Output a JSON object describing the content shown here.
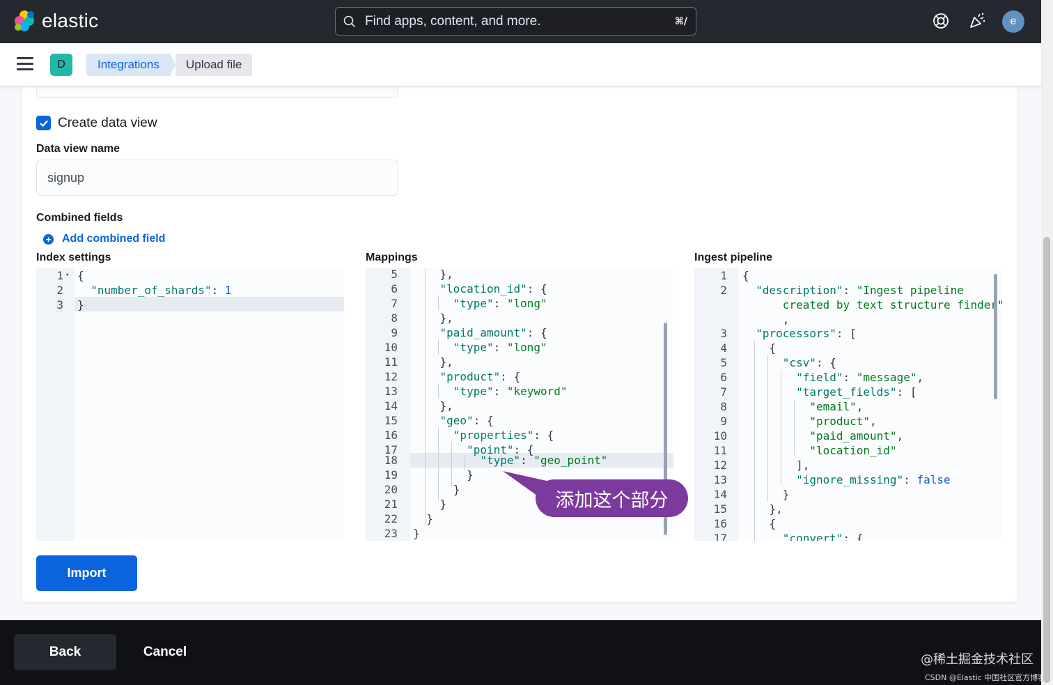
{
  "app": {
    "name": "elastic"
  },
  "search": {
    "placeholder": "Find apps, content, and more.",
    "shortcut": "⌘/"
  },
  "user": {
    "avatar_letter": "e"
  },
  "space": {
    "badge": "D"
  },
  "breadcrumbs": [
    "Integrations",
    "Upload file"
  ],
  "form": {
    "create_data_view_label": "Create data view",
    "create_data_view_checked": true,
    "data_view_name_label": "Data view name",
    "data_view_name_value": "signup",
    "combined_fields_label": "Combined fields",
    "add_combined_field": "Add combined field"
  },
  "editors": {
    "index_settings": {
      "title": "Index settings",
      "lines": [
        "1",
        "2",
        "3"
      ]
    },
    "mappings": {
      "title": "Mappings",
      "lines": [
        "5",
        "6",
        "7",
        "8",
        "9",
        "10",
        "11",
        "12",
        "13",
        "14",
        "15",
        "16",
        "17",
        "18",
        "19",
        "20",
        "21",
        "22",
        "23"
      ]
    },
    "ingest_pipeline": {
      "title": "Ingest pipeline",
      "lines": [
        "1",
        "2",
        "3",
        "4",
        "5",
        "6",
        "7",
        "8",
        "9",
        "10",
        "11",
        "12",
        "13",
        "14",
        "15",
        "16",
        "17"
      ]
    }
  },
  "callout": {
    "text": "添加这个部分"
  },
  "buttons": {
    "import": "Import",
    "back": "Back",
    "cancel": "Cancel"
  },
  "watermarks": {
    "line1": "@稀土掘金技术社区",
    "line2": "CSDN @Elastic 中国社区官方博客"
  },
  "colors": {
    "primary": "#0b64dd",
    "callout": "#7d3a9e",
    "header_bg": "#25282f"
  }
}
